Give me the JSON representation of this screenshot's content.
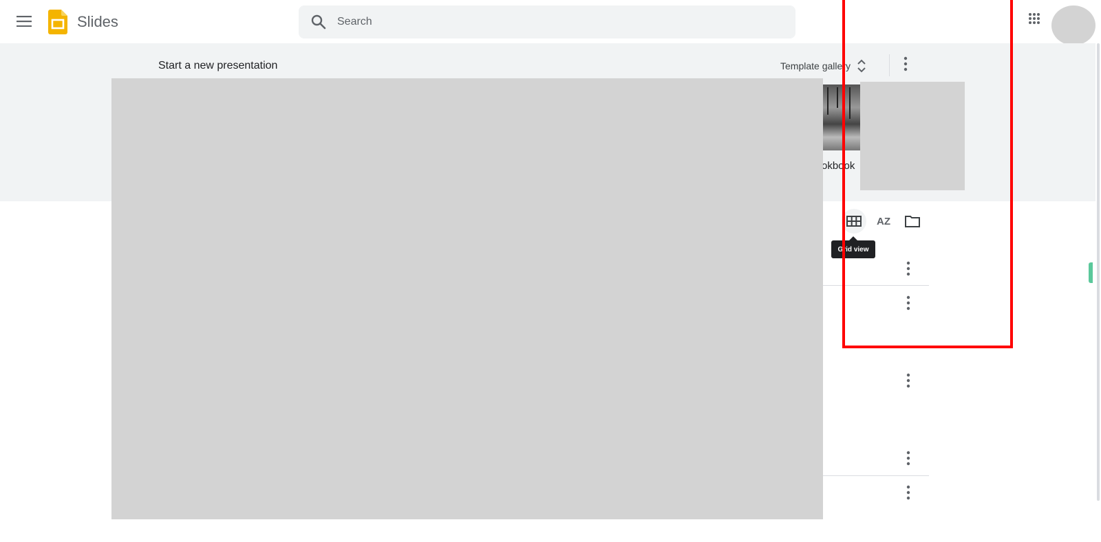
{
  "header": {
    "app_name": "Slides",
    "search_placeholder": "Search"
  },
  "templates": {
    "heading": "Start a new presentation",
    "gallery_label": "Template gallery",
    "visible_template_label": "okbook"
  },
  "toolbar": {
    "tooltip": "Grid view",
    "sort_label": "AZ"
  },
  "icons": {
    "menu": "menu-icon",
    "logo": "slides-logo",
    "search": "search-icon",
    "apps": "apps-grid-icon",
    "unfold": "unfold-more-icon",
    "more": "more-vert-icon",
    "grid_view": "grid-view-icon",
    "sort": "sort-az-icon",
    "folder": "folder-icon"
  },
  "colors": {
    "slides_yellow": "#f4b400",
    "band_bg": "#f1f3f4",
    "highlight": "#ff0000",
    "placeholder_gray": "#d3d3d3",
    "side_accent": "#5bc89b"
  }
}
